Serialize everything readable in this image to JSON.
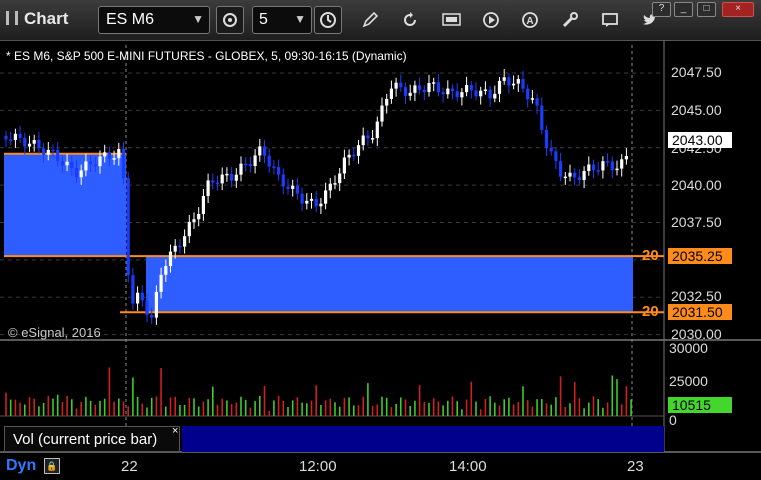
{
  "toolbar": {
    "title": "Chart",
    "symbol": "ES M6",
    "interval": "5",
    "icons": [
      "cursor-sync-icon",
      "clock-icon",
      "pencil-icon",
      "refresh-icon",
      "edit-symbol-icon",
      "play-icon",
      "alert-icon",
      "tools-icon",
      "comment-icon",
      "twitter-icon"
    ]
  },
  "window": {
    "controls": [
      "?",
      "_",
      "□",
      "×"
    ]
  },
  "chart": {
    "title": "* ES M6, S&P 500 E-MINI FUTURES - GLOBEX, 5, 09:30-16:15 (Dynamic)",
    "copyright": "© eSignal, 2016",
    "price_axis": [
      "2047.50",
      "2045.00",
      "2042.50",
      "2040.00",
      "2037.50",
      "2035.00",
      "2032.50",
      "2030.00"
    ],
    "last_price": "2043.00",
    "zone_top_price": "2035.25",
    "zone_bottom_price": "2031.50",
    "zone_label": "20",
    "colors": {
      "up": "#ffffff",
      "down": "#1a3cff",
      "zone": "#2e5eff",
      "zone_line": "#ff8c1a",
      "vol_up": "#3dcc2a",
      "vol_down": "#d02020"
    }
  },
  "volume": {
    "axis": [
      "30000",
      "25000",
      "0"
    ],
    "last": "10515",
    "label": "Vol (current price bar)",
    "close": "×"
  },
  "time_axis": [
    "22",
    "12:00",
    "14:00",
    "23"
  ],
  "footer": {
    "mode": "Dyn"
  }
}
